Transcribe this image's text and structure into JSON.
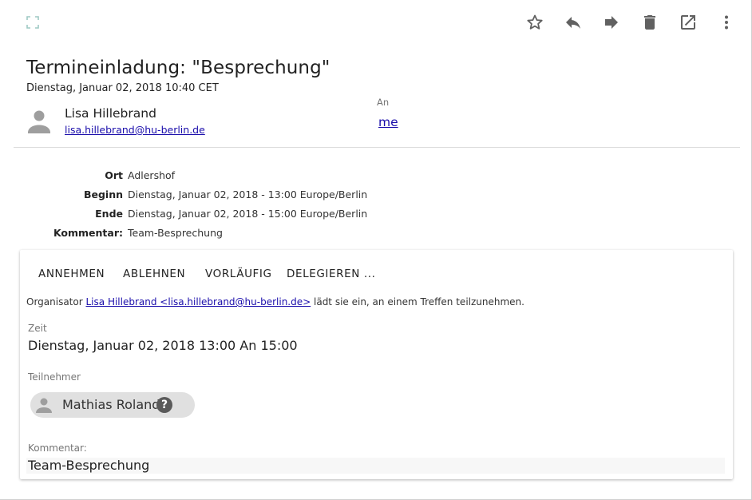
{
  "toolbar": {
    "expand_icon": "expand-icon",
    "icons": [
      "star-icon",
      "reply-icon",
      "forward-icon",
      "delete-icon",
      "open-external-icon",
      "more-vert-icon"
    ]
  },
  "email": {
    "subject": "Termineinladung: \"Besprechung\"",
    "date": "Dienstag, Januar 02, 2018 10:40 CET",
    "sender_name": "Lisa Hillebrand",
    "sender_email": "lisa.hillebrand@hu-berlin.de",
    "to_label": "An",
    "to_value": "me"
  },
  "details": [
    {
      "label": "Ort",
      "value": "Adlershof"
    },
    {
      "label": "Beginn",
      "value": "Dienstag, Januar 02, 2018 - 13:00 Europe/Berlin"
    },
    {
      "label": "Ende",
      "value": "Dienstag, Januar 02, 2018 - 15:00 Europe/Berlin"
    },
    {
      "label": "Kommentar:",
      "value": "Team-Besprechung"
    }
  ],
  "invitation": {
    "actions": [
      "ANNEHMEN",
      "ABLEHNEN",
      "VORLÄUFIG",
      "DELEGIEREN ..."
    ],
    "organizer_prefix": "Organisator",
    "organizer_link": "Lisa Hillebrand <lisa.hillebrand@hu-berlin.de>",
    "organizer_suffix": "lädt sie ein, an einem Treffen teilzunehmen.",
    "time_label": "Zeit",
    "time_value": "Dienstag, Januar 02, 2018 13:00 An 15:00",
    "participants_label": "Teilnehmer",
    "participant_name": "Mathias Roland",
    "participant_status": "?",
    "comment_label": "Kommentar:",
    "comment_value": "Team-Besprechung"
  },
  "colors": {
    "link": "#1a0dab",
    "icon": "#616161",
    "chip": "#e0e0e0"
  }
}
